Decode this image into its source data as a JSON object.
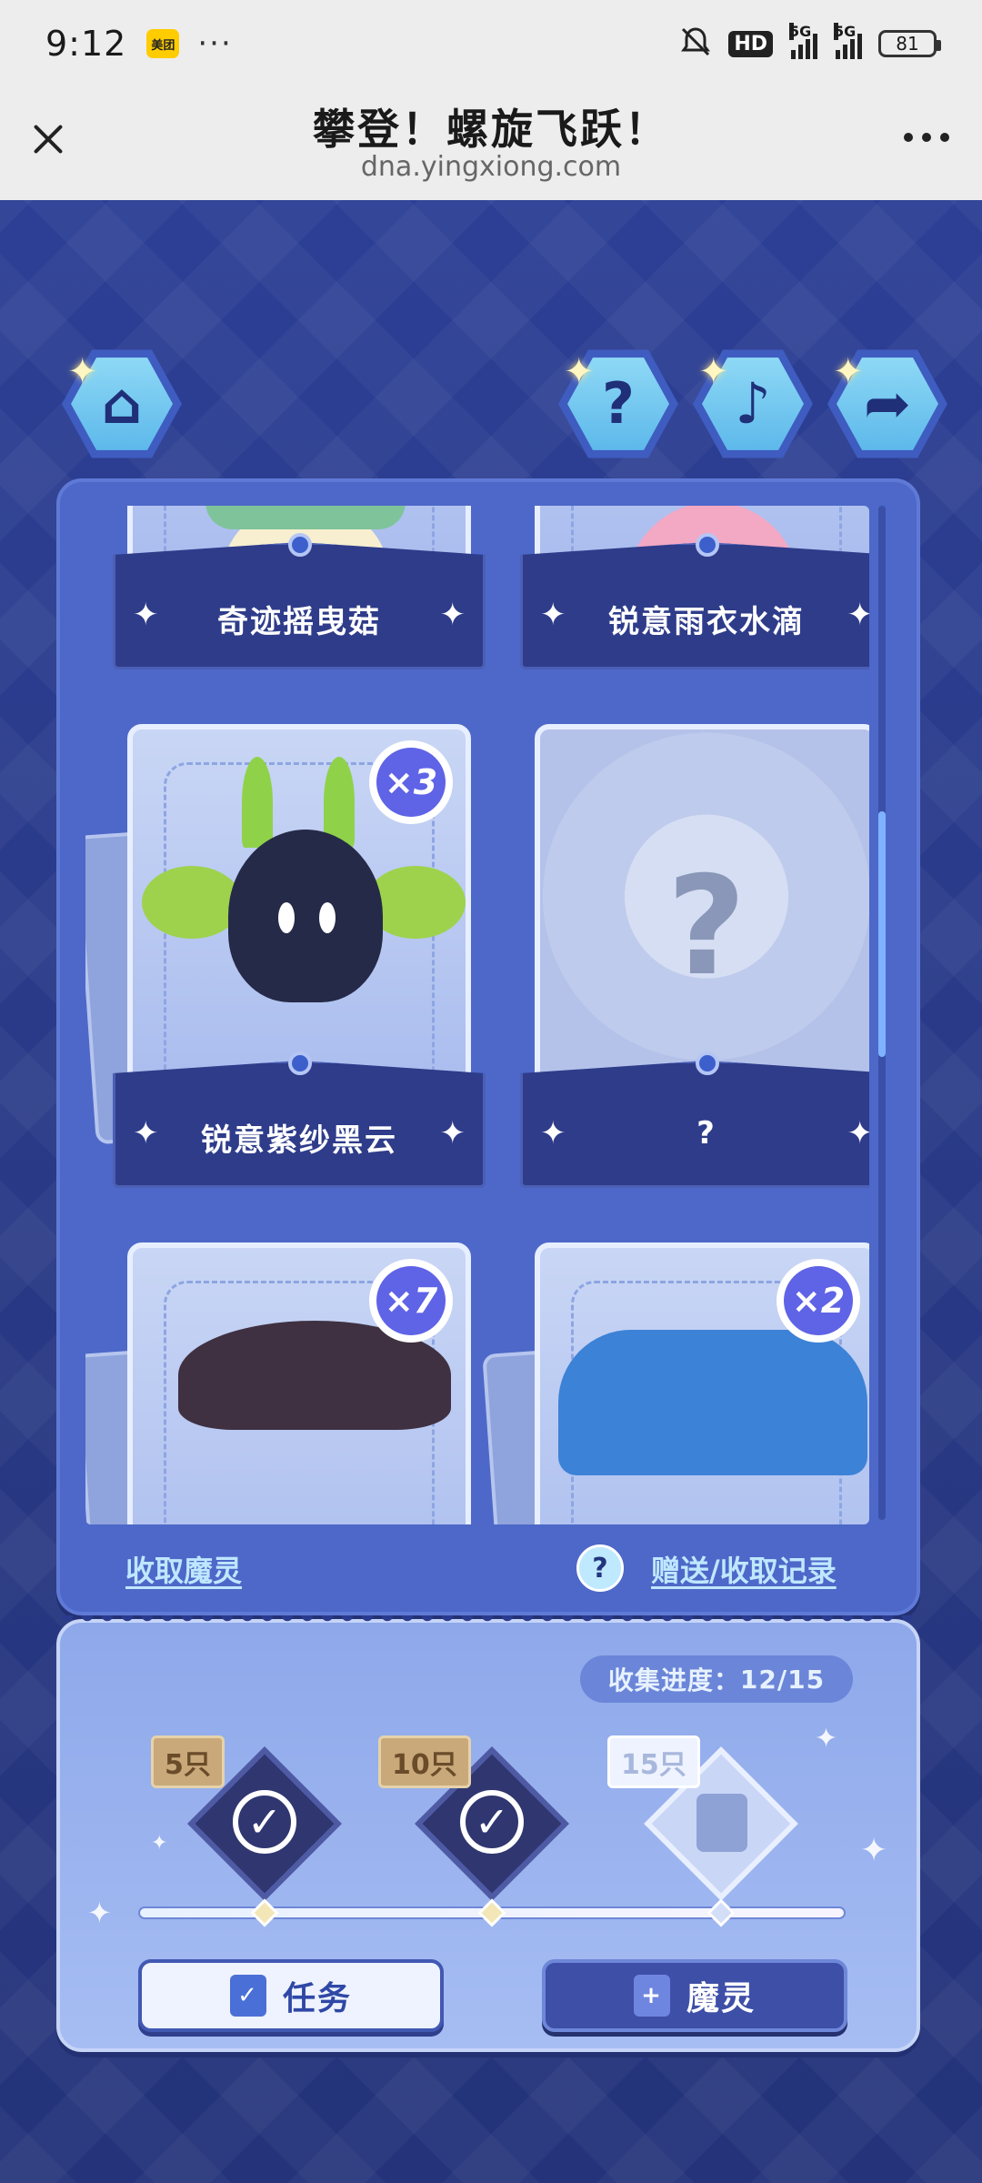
{
  "status_bar": {
    "time": "9:12",
    "app_badge": "美团",
    "more": "···",
    "hd": "HD",
    "signal1": "5G",
    "signal2": "5G",
    "battery": "81"
  },
  "title_bar": {
    "title": "攀登！螺旋飞跃！",
    "url": "dna.yingxiong.com"
  },
  "top_buttons": {
    "home_icon": "⌂",
    "help_icon": "?",
    "music_icon": "♪",
    "share_icon": "➦"
  },
  "cards": [
    {
      "name": "奇迹摇曳菇",
      "count": null
    },
    {
      "name": "锐意雨衣水滴",
      "count": null
    },
    {
      "name": "锐意紫纱黑云",
      "count": "×3"
    },
    {
      "name": "?",
      "count": null
    },
    {
      "name": "",
      "count": "×7"
    },
    {
      "name": "",
      "count": "×2"
    }
  ],
  "panel_links": {
    "collect": "收取魔灵",
    "help": "?",
    "record": "赠送/收取记录"
  },
  "progress": {
    "label": "收集进度：",
    "current": 12,
    "total": 15,
    "text": "12/15",
    "milestones": [
      {
        "label": "5只",
        "done": true
      },
      {
        "label": "10只",
        "done": true
      },
      {
        "label": "15只",
        "done": false
      }
    ],
    "check": "✓"
  },
  "buttons": {
    "task": "任务",
    "spirit": "魔灵"
  },
  "colors": {
    "background": "#2a3b8f",
    "panel": "#4d68c8",
    "accent": "#5f63e6"
  }
}
